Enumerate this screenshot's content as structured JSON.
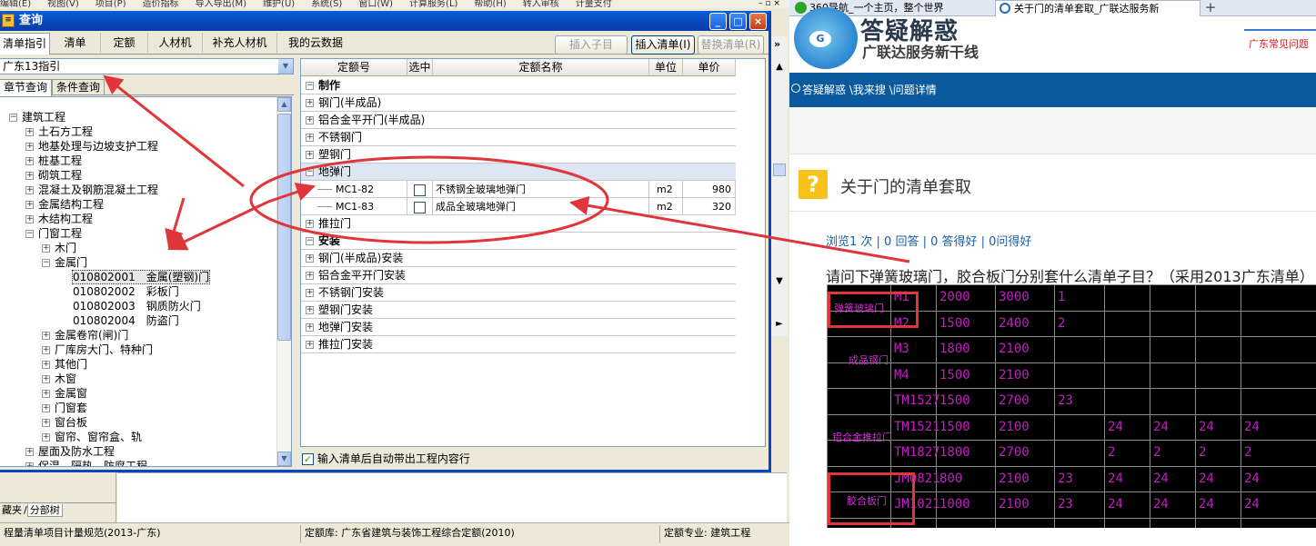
{
  "left_app": {
    "menu": [
      "编辑(E)",
      "视图(V)",
      "项目(P)",
      "造价指标",
      "导入导出(M)",
      "维护(U)",
      "系统(S)",
      "窗口(W)",
      "计算服务(L)",
      "帮助(H)",
      "转入审核",
      "计量支付"
    ],
    "window_controls": "– ▫ ×",
    "sidebar_tabs": [
      "藏夹",
      "分部树"
    ],
    "status": [
      "程量清单项目计量规范(2013-广东)",
      "定额库: 广东省建筑与装饰工程综合定额(2010)",
      "定额专业: 建筑工程"
    ],
    "scroll_arrows": {
      "up": "▲",
      "down": "▼",
      "right": "►"
    }
  },
  "dialog": {
    "title": "查询",
    "icon_glyph": "≡",
    "controls": {
      "minimize": "_",
      "maximize": "□",
      "close": "×"
    },
    "tabs": [
      "清单指引",
      "清单",
      "定额",
      "人材机",
      "补充人材机",
      "我的云数据"
    ],
    "active_tab": "清单指引",
    "buttons": {
      "insert_child": "插入子目",
      "insert_list": "插入清单(I)",
      "replace_list": "替换清单(R)"
    },
    "overflow": "»",
    "guide_select": "广东13指引",
    "subtabs": [
      "章节查询",
      "条件查询"
    ],
    "tree": [
      {
        "label": "建筑工程",
        "level": 0,
        "toggle": "−"
      },
      {
        "label": "土石方工程",
        "level": 1,
        "toggle": "+"
      },
      {
        "label": "地基处理与边坡支护工程",
        "level": 1,
        "toggle": "+"
      },
      {
        "label": "桩基工程",
        "level": 1,
        "toggle": "+"
      },
      {
        "label": "砌筑工程",
        "level": 1,
        "toggle": "+"
      },
      {
        "label": "混凝土及钢筋混凝土工程",
        "level": 1,
        "toggle": "+"
      },
      {
        "label": "金属结构工程",
        "level": 1,
        "toggle": "+"
      },
      {
        "label": "木结构工程",
        "level": 1,
        "toggle": "+"
      },
      {
        "label": "门窗工程",
        "level": 1,
        "toggle": "−"
      },
      {
        "label": "木门",
        "level": 2,
        "toggle": "+"
      },
      {
        "label": "金属门",
        "level": 2,
        "toggle": "−"
      },
      {
        "label": "010802001　金属(塑钢)门",
        "level": 3,
        "toggle": "",
        "selected": true
      },
      {
        "label": "010802002　彩板门",
        "level": 3,
        "toggle": ""
      },
      {
        "label": "010802003　钢质防火门",
        "level": 3,
        "toggle": ""
      },
      {
        "label": "010802004　防盗门",
        "level": 3,
        "toggle": ""
      },
      {
        "label": "金属卷帘(闸)门",
        "level": 2,
        "toggle": "+"
      },
      {
        "label": "厂库房大门、特种门",
        "level": 2,
        "toggle": "+"
      },
      {
        "label": "其他门",
        "level": 2,
        "toggle": "+"
      },
      {
        "label": "木窗",
        "level": 2,
        "toggle": "+"
      },
      {
        "label": "金属窗",
        "level": 2,
        "toggle": "+"
      },
      {
        "label": "门窗套",
        "level": 2,
        "toggle": "+"
      },
      {
        "label": "窗台板",
        "level": 2,
        "toggle": "+"
      },
      {
        "label": "窗帘、窗帘盒、轨",
        "level": 2,
        "toggle": "+"
      },
      {
        "label": "屋面及防水工程",
        "level": 1,
        "toggle": "+"
      },
      {
        "label": "保温、隔热、防腐工程",
        "level": 1,
        "toggle": "+"
      }
    ],
    "grid_headers": [
      "定额号",
      "选中",
      "定额名称",
      "单位",
      "单价"
    ],
    "grid_rows": [
      {
        "kind": "group",
        "toggle": "−",
        "label": "制作"
      },
      {
        "kind": "sub",
        "toggle": "+",
        "label": "钢门(半成品)"
      },
      {
        "kind": "sub",
        "toggle": "+",
        "label": "铝合金平开门(半成品)"
      },
      {
        "kind": "sub",
        "toggle": "+",
        "label": "不锈钢门"
      },
      {
        "kind": "sub",
        "toggle": "+",
        "label": "塑钢门"
      },
      {
        "kind": "sub",
        "toggle": "−",
        "label": "地弹门",
        "highlight": true
      },
      {
        "kind": "item",
        "code": "MC1-82",
        "name": "不锈钢全玻璃地弹门",
        "unit": "m2",
        "price": "980"
      },
      {
        "kind": "item",
        "code": "MC1-83",
        "name": "成品全玻璃地弹门",
        "unit": "m2",
        "price": "320"
      },
      {
        "kind": "sub",
        "toggle": "+",
        "label": "推拉门"
      },
      {
        "kind": "group",
        "toggle": "−",
        "label": "安装"
      },
      {
        "kind": "sub",
        "toggle": "+",
        "label": "钢门(半成品)安装"
      },
      {
        "kind": "sub",
        "toggle": "+",
        "label": "铝合金平开门安装"
      },
      {
        "kind": "sub",
        "toggle": "+",
        "label": "不锈钢门安装"
      },
      {
        "kind": "sub",
        "toggle": "+",
        "label": "塑钢门安装"
      },
      {
        "kind": "sub",
        "toggle": "+",
        "label": "地弹门安装"
      },
      {
        "kind": "sub",
        "toggle": "+",
        "label": "推拉门安装"
      }
    ],
    "auto_bring_label": "输入清单后自动带出工程内容行",
    "auto_bring_checked": true
  },
  "browser": {
    "tabs": [
      "360导航_一个主页，整个世界",
      "关于门的清单套取_广联达服务新"
    ],
    "new_tab": "+",
    "brand_title": "答疑解惑",
    "brand_sub": "广联达服务新干线",
    "brand_right": "广东常见问题",
    "logo_letter": "G",
    "breadcrumb": "答疑解惑 \\我来搜 \\问题详情",
    "question_icon": "?",
    "question_title": "关于门的清单套取",
    "stats": "浏览1 次 | 0 回答 | 0 答得好 | 0问得好",
    "question_text": "请问下弹簧玻璃门，胶合板门分别套什么清单子目？（采用2013广东清单）",
    "cad_labels": [
      "弹簧玻璃门",
      "成品钢门",
      "铝合金推拉门",
      "胶合板门"
    ],
    "cad_rows": [
      [
        "M1",
        "2000",
        "3000",
        "1",
        "",
        "",
        "",
        ""
      ],
      [
        "M2",
        "1500",
        "2400",
        "2",
        "",
        "",
        "",
        ""
      ],
      [
        "M3",
        "1800",
        "2100",
        "",
        "",
        "",
        "",
        ""
      ],
      [
        "M4",
        "1500",
        "2100",
        "",
        "",
        "",
        "",
        ""
      ],
      [
        "TM1527",
        "1500",
        "2700",
        "23",
        "",
        "",
        "",
        ""
      ],
      [
        "TM1521",
        "1500",
        "2100",
        "",
        "24",
        "24",
        "24",
        "24"
      ],
      [
        "TM1827",
        "1800",
        "2700",
        "",
        "2",
        "2",
        "2",
        "2"
      ],
      [
        "JM0821",
        "800",
        "2100",
        "23",
        "24",
        "24",
        "24",
        "24"
      ],
      [
        "JM1021",
        "1000",
        "2100",
        "23",
        "24",
        "24",
        "24",
        "24"
      ]
    ]
  },
  "colors": {
    "annotation_red": "#e0353a",
    "titlebar_blue": "#0a5fd8",
    "nav_blue": "#0c5a9e",
    "cad_magenta": "#c21ec2"
  }
}
